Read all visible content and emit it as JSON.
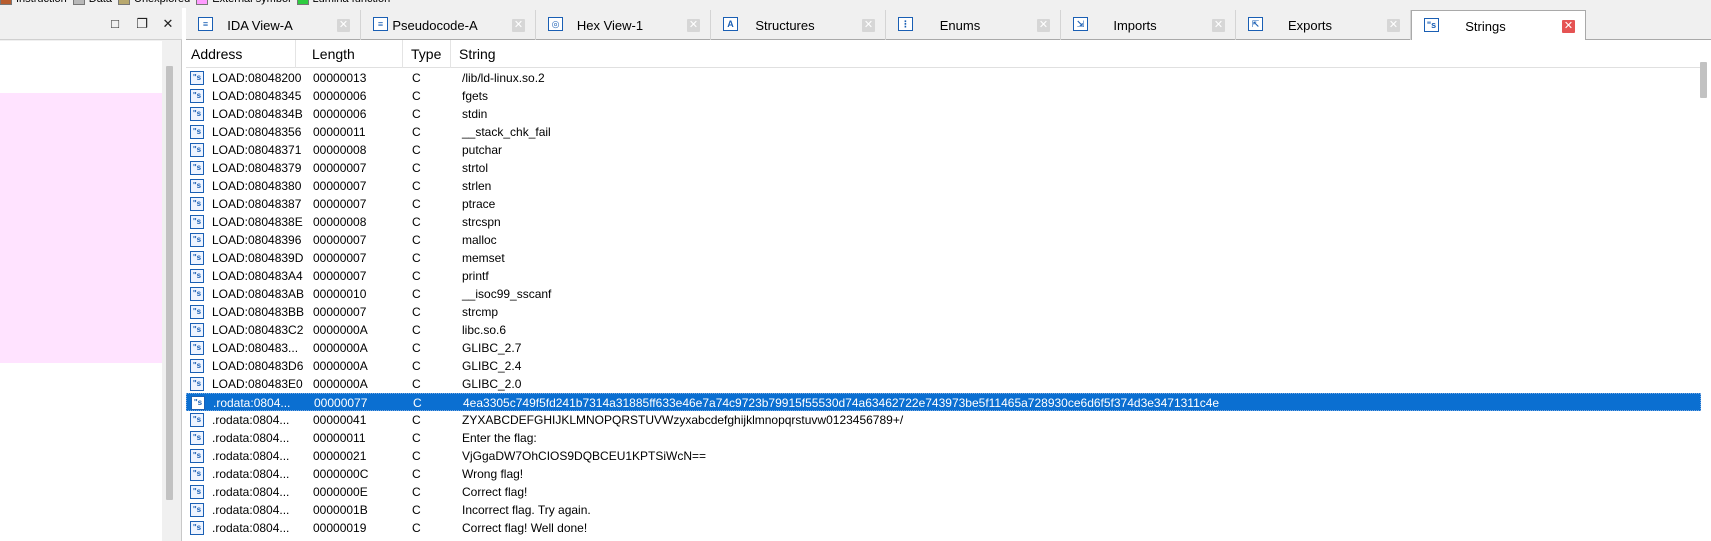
{
  "legend": [
    {
      "label": "Instruction",
      "color": "#b85c2e"
    },
    {
      "label": "Data",
      "color": "#b8b8b8"
    },
    {
      "label": "Unexplored",
      "color": "#b8a86e"
    },
    {
      "label": "External symbol",
      "color": "#ff9cff"
    },
    {
      "label": "Lumina function",
      "color": "#2ecc40"
    }
  ],
  "left_panel": {
    "buttons": {
      "maximize": "□",
      "restore": "❐",
      "close": "✕"
    }
  },
  "tabs": [
    {
      "label": "IDA View-A",
      "icon": "ida-view-icon",
      "active": false
    },
    {
      "label": "Pseudocode-A",
      "icon": "pseudocode-icon",
      "active": false
    },
    {
      "label": "Hex View-1",
      "icon": "hex-view-icon",
      "active": false
    },
    {
      "label": "Structures",
      "icon": "structures-icon",
      "active": false
    },
    {
      "label": "Enums",
      "icon": "enums-icon",
      "active": false
    },
    {
      "label": "Imports",
      "icon": "imports-icon",
      "active": false
    },
    {
      "label": "Exports",
      "icon": "exports-icon",
      "active": false
    },
    {
      "label": "Strings",
      "icon": "strings-icon",
      "active": true
    }
  ],
  "columns": [
    "Address",
    "Length",
    "Type",
    "String"
  ],
  "rows": [
    {
      "address": "LOAD:08048200",
      "length": "00000013",
      "type": "C",
      "string": "/lib/ld-linux.so.2"
    },
    {
      "address": "LOAD:08048345",
      "length": "00000006",
      "type": "C",
      "string": "fgets"
    },
    {
      "address": "LOAD:0804834B",
      "length": "00000006",
      "type": "C",
      "string": "stdin"
    },
    {
      "address": "LOAD:08048356",
      "length": "00000011",
      "type": "C",
      "string": "__stack_chk_fail"
    },
    {
      "address": "LOAD:08048371",
      "length": "00000008",
      "type": "C",
      "string": "putchar"
    },
    {
      "address": "LOAD:08048379",
      "length": "00000007",
      "type": "C",
      "string": "strtol"
    },
    {
      "address": "LOAD:08048380",
      "length": "00000007",
      "type": "C",
      "string": "strlen"
    },
    {
      "address": "LOAD:08048387",
      "length": "00000007",
      "type": "C",
      "string": "ptrace"
    },
    {
      "address": "LOAD:0804838E",
      "length": "00000008",
      "type": "C",
      "string": "strcspn"
    },
    {
      "address": "LOAD:08048396",
      "length": "00000007",
      "type": "C",
      "string": "malloc"
    },
    {
      "address": "LOAD:0804839D",
      "length": "00000007",
      "type": "C",
      "string": "memset"
    },
    {
      "address": "LOAD:080483A4",
      "length": "00000007",
      "type": "C",
      "string": "printf"
    },
    {
      "address": "LOAD:080483AB",
      "length": "00000010",
      "type": "C",
      "string": "__isoc99_sscanf"
    },
    {
      "address": "LOAD:080483BB",
      "length": "00000007",
      "type": "C",
      "string": "strcmp"
    },
    {
      "address": "LOAD:080483C2",
      "length": "0000000A",
      "type": "C",
      "string": "libc.so.6"
    },
    {
      "address": "LOAD:080483...",
      "length": "0000000A",
      "type": "C",
      "string": "GLIBC_2.7"
    },
    {
      "address": "LOAD:080483D6",
      "length": "0000000A",
      "type": "C",
      "string": "GLIBC_2.4"
    },
    {
      "address": "LOAD:080483E0",
      "length": "0000000A",
      "type": "C",
      "string": "GLIBC_2.0"
    },
    {
      "address": ".rodata:0804...",
      "length": "00000077",
      "type": "C",
      "string": "4ea3305c749f5fd241b7314a31885ff633e46e7a74c9723b79915f55530d74a63462722e743973be5f11465a728930ce6d6f5f374d3e3471311c4e",
      "selected": true
    },
    {
      "address": ".rodata:0804...",
      "length": "00000041",
      "type": "C",
      "string": "ZYXABCDEFGHIJKLMNOPQRSTUVWzyxabcdefghijklmnopqrstuvw0123456789+/"
    },
    {
      "address": ".rodata:0804...",
      "length": "00000011",
      "type": "C",
      "string": "Enter the flag:"
    },
    {
      "address": ".rodata:0804...",
      "length": "00000021",
      "type": "C",
      "string": "VjGgaDW7OhCIOS9DQBCEU1KPTSiWcN=="
    },
    {
      "address": ".rodata:0804...",
      "length": "0000000C",
      "type": "C",
      "string": "Wrong flag!"
    },
    {
      "address": ".rodata:0804...",
      "length": "0000000E",
      "type": "C",
      "string": "Correct flag!"
    },
    {
      "address": ".rodata:0804...",
      "length": "0000001B",
      "type": "C",
      "string": "Incorrect flag. Try again."
    },
    {
      "address": ".rodata:0804...",
      "length": "00000019",
      "type": "C",
      "string": "Correct flag! Well done!"
    }
  ],
  "colors": {
    "selected_row": "#0b6fd1",
    "pink_block": "#ffe3ff"
  }
}
